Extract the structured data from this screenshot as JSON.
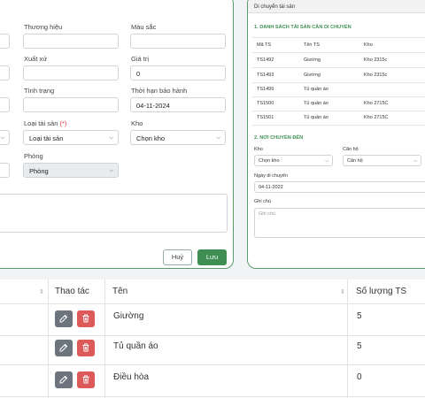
{
  "form": {
    "brand_label": "Thương hiệu",
    "color_label": "Màu sắc",
    "origin_label": "Xuất xứ",
    "value_label": "Giá trị",
    "value_value": "0",
    "status_label": "Tình trạng",
    "warranty_label": "Thời hạn bảo hành",
    "warranty_value": "04-11-2024",
    "asset_type_label": "Loại tài sản",
    "asset_type_required": "(*)",
    "asset_type_value": "Loại tài sản",
    "warehouse_label": "Kho",
    "warehouse_value": "Chọn kho",
    "room_label": "Phòng",
    "room_value": "Phòng",
    "cancel_label": "Huỷ",
    "save_label": "Lưu"
  },
  "transfer": {
    "title": "Di chuyển tài sản",
    "list_heading": "1. DANH SÁCH TÀI SẢN CẦN DI CHUYỂN",
    "columns": [
      "Mã TS",
      "Tên TS",
      "Kho"
    ],
    "rows": [
      [
        "TS1492",
        "Giường",
        "Kho 2315c"
      ],
      [
        "TS1493",
        "Giường",
        "Kho 2315c"
      ],
      [
        "TS1499",
        "Tủ quần áo",
        ""
      ],
      [
        "TS1500",
        "Tủ quần áo",
        "Kho 2715C"
      ],
      [
        "TS1501",
        "Tủ quần áo",
        "Kho 2715C"
      ]
    ],
    "dest_heading": "2. NƠI CHUYỂN ĐẾN",
    "warehouse_label": "Kho",
    "warehouse_value": "Chọn kho",
    "apartment_label": "Căn hộ",
    "apartment_value": "Căn hộ",
    "date_label": "Ngày di chuyển",
    "date_value": "04-11-2022",
    "note_label": "Ghi chú",
    "note_placeholder": "Ghi chú"
  },
  "table": {
    "headers": {
      "actions": "Thao tác",
      "name": "Tên",
      "count": "Số lượng TS"
    },
    "rows": [
      {
        "name": "Giường",
        "count": "5"
      },
      {
        "name": "Tủ quần áo",
        "count": "5"
      },
      {
        "name": "Điều hòa",
        "count": "0"
      }
    ]
  }
}
